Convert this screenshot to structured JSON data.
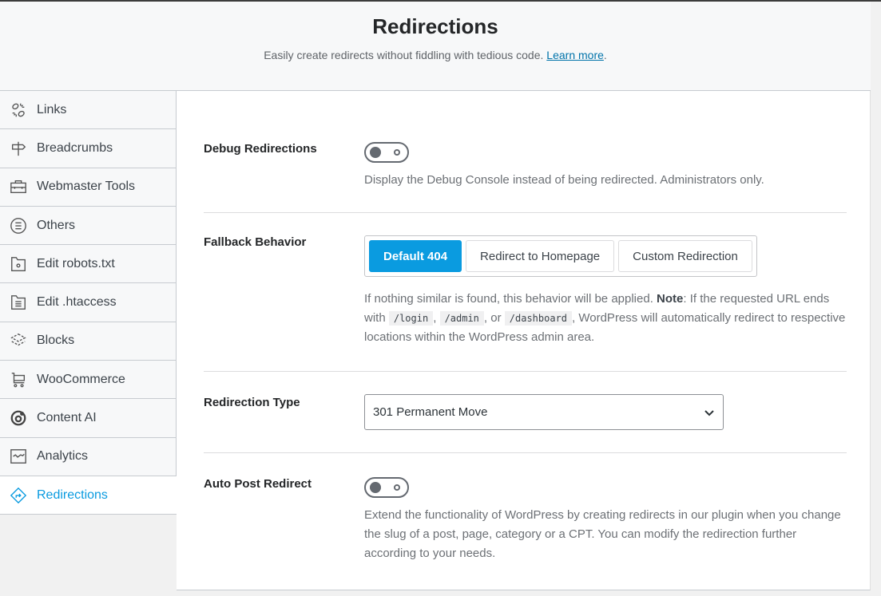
{
  "header": {
    "title": "Redirections",
    "subtitle": "Easily create redirects without fiddling with tedious code.",
    "learn_more": "Learn more",
    "period": "."
  },
  "sidebar": {
    "items": [
      {
        "label": "Links",
        "icon": "link-broken-icon"
      },
      {
        "label": "Breadcrumbs",
        "icon": "signpost-icon"
      },
      {
        "label": "Webmaster Tools",
        "icon": "toolbox-icon"
      },
      {
        "label": "Others",
        "icon": "list-circle-icon"
      },
      {
        "label": "Edit robots.txt",
        "icon": "folder-robot-icon"
      },
      {
        "label": "Edit .htaccess",
        "icon": "folder-file-icon"
      },
      {
        "label": "Blocks",
        "icon": "blocks-icon"
      },
      {
        "label": "WooCommerce",
        "icon": "cart-icon"
      },
      {
        "label": "Content AI",
        "icon": "content-ai-icon"
      },
      {
        "label": "Analytics",
        "icon": "analytics-icon"
      },
      {
        "label": "Redirections",
        "icon": "redirect-icon",
        "active": true
      }
    ]
  },
  "settings": {
    "debug": {
      "label": "Debug Redirections",
      "enabled": false,
      "desc": "Display the Debug Console instead of being redirected. Administrators only."
    },
    "fallback": {
      "label": "Fallback Behavior",
      "options": [
        "Default 404",
        "Redirect to Homepage",
        "Custom Redirection"
      ],
      "selected": "Default 404",
      "desc1": "If nothing similar is found, this behavior will be applied.",
      "note": "Note",
      "desc2": ": If the requested URL ends with",
      "code1": "/login",
      "sep1": ",",
      "code2": "/admin",
      "sep2": ", or",
      "code3": "/dashboard",
      "desc3": ", WordPress will automatically redirect to respective locations within the WordPress admin area."
    },
    "type": {
      "label": "Redirection Type",
      "value": "301 Permanent Move"
    },
    "auto": {
      "label": "Auto Post Redirect",
      "enabled": false,
      "desc": "Extend the functionality of WordPress by creating redirects in our plugin when you change the slug of a post, page, category or a CPT. You can modify the redirection further according to your needs."
    }
  },
  "colors": {
    "accent": "#0a9be0"
  }
}
